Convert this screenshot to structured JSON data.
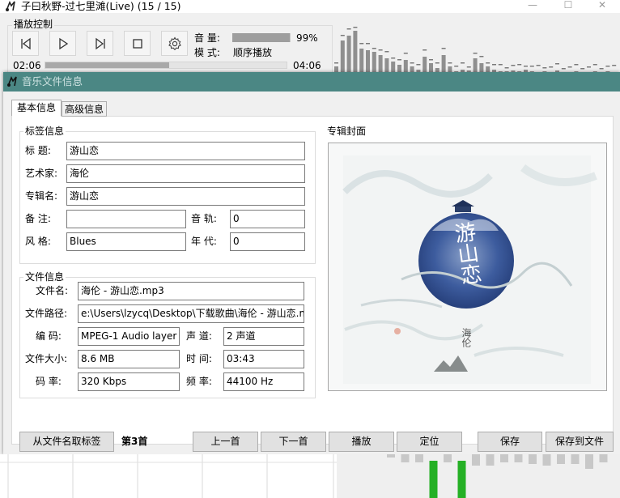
{
  "player": {
    "title": "子曰秋野-过七里滩(Live) (15 / 15)",
    "playback_group_label": "播放控制",
    "volume_label": "音 量:",
    "volume_value": "99%",
    "volume_level": 0.99,
    "mode_label": "模 式:",
    "mode_value": "顺序播放",
    "elapsed": "02:06",
    "total": "04:06",
    "progress_fraction": 0.512
  },
  "dialog": {
    "title": "音乐文件信息",
    "tabs": [
      {
        "label": "基本信息",
        "active": true
      },
      {
        "label": "高级信息",
        "active": false
      }
    ],
    "tag_group": {
      "label": "标签信息",
      "title_label": "标 题:",
      "title_value": "游山恋",
      "artist_label": "艺术家:",
      "artist_value": "海伦",
      "album_label": "专辑名:",
      "album_value": "游山恋",
      "comment_label": "备 注:",
      "comment_value": "",
      "track_label": "音 轨:",
      "track_value": "0",
      "genre_label": "风 格:",
      "genre_value": "Blues",
      "year_label": "年 代:",
      "year_value": "0"
    },
    "file_group": {
      "label": "文件信息",
      "filename_label": "文件名:",
      "filename_value": "海伦 - 游山恋.mp3",
      "path_label": "文件路径:",
      "path_value": "e:\\Users\\lzycq\\Desktop\\下载歌曲\\海伦 - 游山恋.m",
      "codec_label": "编 码:",
      "codec_value": "MPEG-1 Audio layer",
      "channels_label": "声 道:",
      "channels_value": "2 声道",
      "size_label": "文件大小:",
      "size_value": "8.6 MB",
      "duration_label": "时 间:",
      "duration_value": "03:43",
      "bitrate_label": "码 率:",
      "bitrate_value": "320 Kbps",
      "samplerate_label": "频 率:",
      "samplerate_value": "44100 Hz"
    },
    "cover_group": {
      "label": "专辑封面",
      "art_title": "游山恋",
      "art_artist": "海伦"
    },
    "buttons": {
      "from_filename": "从文件名取标签",
      "track_number": "第3首",
      "prev": "上一首",
      "next": "下一首",
      "play": "播放",
      "locate": "定位",
      "save": "保存",
      "save_to_file": "保存到文件"
    }
  },
  "colors": {
    "dialog_title_bg": "#4b8784",
    "dialog_title_text": "#cfe3e2",
    "cover_circle": "#3b5a9c",
    "bar_green": "#25b025"
  }
}
